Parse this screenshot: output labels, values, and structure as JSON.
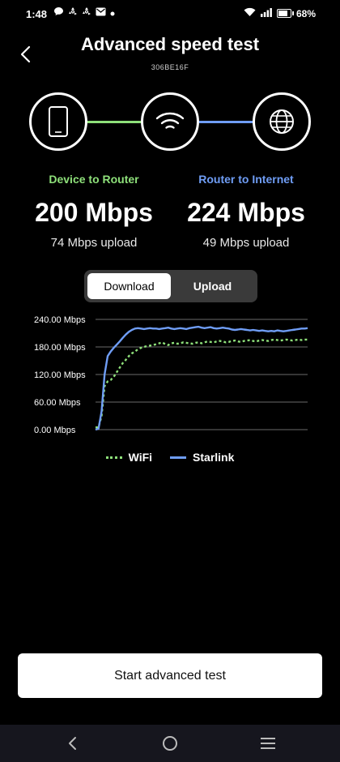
{
  "status_bar": {
    "time": "1:48",
    "battery": "68%",
    "battery_level": 0.68,
    "notification_icons": [
      "chat-bubble-icon",
      "recycle-icon",
      "recycle-icon",
      "mail-icon",
      "dot-icon"
    ]
  },
  "header": {
    "title": "Advanced speed test",
    "device_id": "306BE16F"
  },
  "diagram": {
    "nodes": [
      "phone-icon",
      "wifi-icon",
      "globe-icon"
    ],
    "link_colors": [
      "#8ee07a",
      "#6f9df5"
    ]
  },
  "results": {
    "device_to_router": {
      "label": "Device to Router",
      "download": "200 Mbps",
      "upload": "74 Mbps upload",
      "color": "#8ee07a"
    },
    "router_to_internet": {
      "label": "Router to Internet",
      "download": "224 Mbps",
      "upload": "49 Mbps upload",
      "color": "#6f9df5"
    }
  },
  "toggle": {
    "download": "Download",
    "upload": "Upload",
    "selected": "Download"
  },
  "chart_data": {
    "type": "line",
    "ylim": [
      0,
      240
    ],
    "grid": true,
    "y_ticks": [
      "0.00 Mbps",
      "60.00 Mbps",
      "120.00 Mbps",
      "180.00 Mbps",
      "240.00 Mbps"
    ],
    "legend_position": "bottom",
    "x": [
      0,
      1,
      2,
      3,
      4,
      5,
      6,
      7,
      8,
      9,
      10,
      11,
      12,
      13,
      14,
      15,
      16,
      17,
      18,
      19,
      20,
      21,
      22,
      23,
      24,
      25,
      26,
      27,
      28,
      29,
      30,
      31,
      32,
      33,
      34,
      35,
      36,
      37,
      38,
      39,
      40,
      41,
      42,
      43,
      44,
      45,
      46,
      47,
      48,
      49,
      50,
      51,
      52,
      53,
      54,
      55,
      56,
      57,
      58,
      59,
      60,
      61,
      62,
      63,
      64,
      65,
      66,
      67,
      68,
      69,
      70
    ],
    "series": [
      {
        "name": "WiFi",
        "style": "dotted",
        "color": "#8ee07a",
        "values": [
          5,
          5,
          30,
          95,
          105,
          108,
          115,
          125,
          135,
          145,
          152,
          160,
          166,
          170,
          175,
          178,
          180,
          182,
          183,
          184,
          186,
          188,
          190,
          186,
          184,
          188,
          189,
          187,
          188,
          190,
          189,
          188,
          187,
          189,
          190,
          188,
          190,
          192,
          191,
          190,
          192,
          193,
          192,
          190,
          191,
          193,
          194,
          192,
          191,
          193,
          194,
          195,
          193,
          192,
          194,
          195,
          194,
          193,
          195,
          196,
          195,
          194,
          195,
          196,
          195,
          194,
          195,
          196,
          195,
          196,
          196
        ]
      },
      {
        "name": "Starlink",
        "style": "solid",
        "color": "#6f9df5",
        "values": [
          0,
          2,
          40,
          120,
          160,
          170,
          178,
          185,
          192,
          200,
          207,
          213,
          217,
          220,
          221,
          220,
          219,
          220,
          221,
          220,
          220,
          219,
          220,
          221,
          222,
          220,
          219,
          220,
          221,
          220,
          219,
          221,
          222,
          223,
          224,
          222,
          221,
          222,
          223,
          221,
          220,
          221,
          222,
          221,
          220,
          218,
          217,
          218,
          219,
          218,
          217,
          216,
          217,
          216,
          215,
          216,
          215,
          214,
          215,
          214,
          216,
          215,
          214,
          215,
          216,
          217,
          218,
          219,
          220,
          220,
          221
        ]
      }
    ]
  },
  "actions": {
    "start_button": "Start advanced test"
  },
  "nav": {
    "back": "back-nav-icon",
    "home": "home-nav-icon",
    "recents": "recents-nav-icon"
  }
}
